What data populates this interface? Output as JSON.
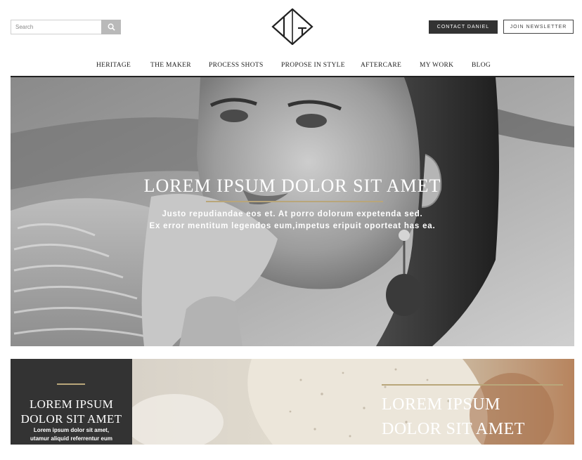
{
  "search": {
    "placeholder": "Search",
    "button_icon": "search-icon"
  },
  "logo": {
    "icon": "dg-monogram-logo"
  },
  "buttons": {
    "contact": "CONTACT DANIEL",
    "newsletter": "JOIN NEWSLETTER"
  },
  "nav": {
    "items": [
      {
        "label": "HERITAGE"
      },
      {
        "label": "THE MAKER"
      },
      {
        "label": "PROCESS SHOTS"
      },
      {
        "label": "PROPOSE IN STYLE"
      },
      {
        "label": "AFTERCARE"
      },
      {
        "label": "MY WORK"
      },
      {
        "label": "BLOG"
      }
    ]
  },
  "hero": {
    "title": "LOREM IPSUM DOLOR SIT AMET",
    "subtitle_line1": "Justo repudiandae eos et. At porro dolorum expetenda sed.",
    "subtitle_line2": "Ex error mentitum legendos eum,impetus eripuit oporteat has ea."
  },
  "promo": {
    "left_title_line1": "LOREM IPSUM",
    "left_title_line2": "DOLOR SIT AMET",
    "left_text_line1": "Lorem ipsum dolor sit amet,",
    "left_text_line2": "utamur aliquid referrentur eum",
    "right_title_line1": "LOREM IPSUM",
    "right_title_line2": "DOLOR SIT AMET"
  },
  "colors": {
    "accent_gold": "#b9a67a",
    "dark": "#333333",
    "search_button": "#b9b9b9"
  }
}
